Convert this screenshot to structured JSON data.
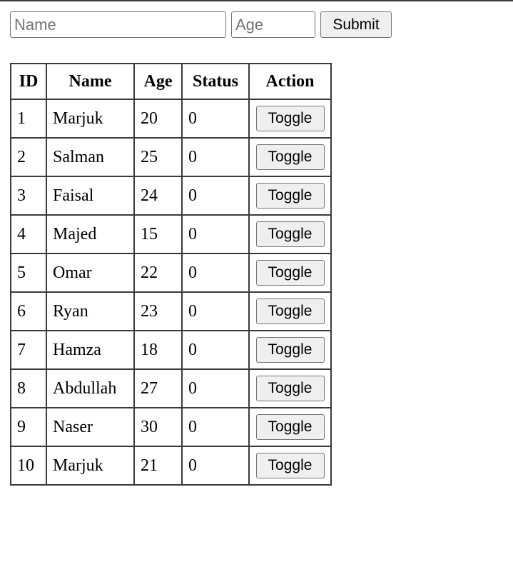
{
  "form": {
    "name_placeholder": "Name",
    "age_placeholder": "Age",
    "submit_label": "Submit"
  },
  "table": {
    "headers": [
      "ID",
      "Name",
      "Age",
      "Status",
      "Action"
    ],
    "rows": [
      {
        "id": "1",
        "name": "Marjuk",
        "age": "20",
        "status": "0",
        "action": "Toggle"
      },
      {
        "id": "2",
        "name": "Salman",
        "age": "25",
        "status": "0",
        "action": "Toggle"
      },
      {
        "id": "3",
        "name": "Faisal",
        "age": "24",
        "status": "0",
        "action": "Toggle"
      },
      {
        "id": "4",
        "name": "Majed",
        "age": "15",
        "status": "0",
        "action": "Toggle"
      },
      {
        "id": "5",
        "name": "Omar",
        "age": "22",
        "status": "0",
        "action": "Toggle"
      },
      {
        "id": "6",
        "name": "Ryan",
        "age": "23",
        "status": "0",
        "action": "Toggle"
      },
      {
        "id": "7",
        "name": "Hamza",
        "age": "18",
        "status": "0",
        "action": "Toggle"
      },
      {
        "id": "8",
        "name": "Abdullah",
        "age": "27",
        "status": "0",
        "action": "Toggle"
      },
      {
        "id": "9",
        "name": "Naser",
        "age": "30",
        "status": "0",
        "action": "Toggle"
      },
      {
        "id": "10",
        "name": "Marjuk",
        "age": "21",
        "status": "0",
        "action": "Toggle"
      }
    ]
  }
}
